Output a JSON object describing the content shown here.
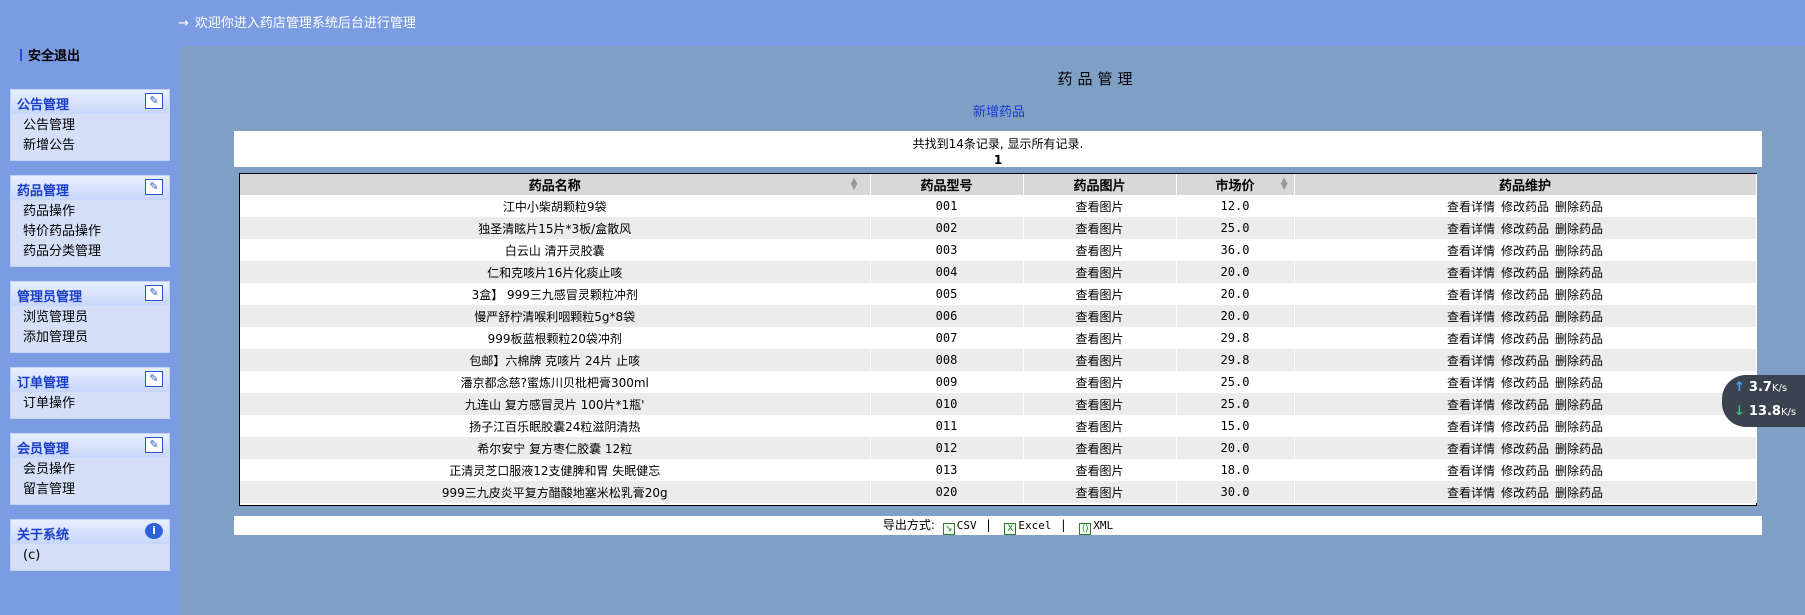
{
  "header": {
    "arrow": "→",
    "welcome": "欢迎你进入药店管理系统后台进行管理"
  },
  "sidebar": {
    "logout": "安全退出",
    "menus": [
      {
        "title": "公告管理",
        "icon": "edit-icon",
        "items": [
          "公告管理",
          "新增公告"
        ]
      },
      {
        "title": "药品管理",
        "icon": "edit-icon",
        "items": [
          "药品操作",
          "特价药品操作",
          "药品分类管理"
        ]
      },
      {
        "title": "管理员管理",
        "icon": "edit-icon",
        "items": [
          "浏览管理员",
          "添加管理员"
        ]
      },
      {
        "title": "订单管理",
        "icon": "edit-icon",
        "items": [
          "订单操作"
        ]
      },
      {
        "title": "会员管理",
        "icon": "edit-icon",
        "items": [
          "会员操作",
          "留言管理"
        ]
      },
      {
        "title": "关于系统",
        "icon": "info-icon",
        "items": [
          "(c)"
        ]
      }
    ]
  },
  "main": {
    "title": "药品管理",
    "add_link": "新增药品",
    "record_info": "共找到14条记录, 显示所有记录.",
    "page": "1",
    "columns": [
      "药品名称",
      "药品型号",
      "药品图片",
      "市场价",
      "药品维护"
    ],
    "rows": [
      {
        "name": "江中小柴胡颗粒9袋",
        "model": "001",
        "image": "查看图片",
        "price": "12.0"
      },
      {
        "name": "独圣清眩片15片*3板/盒散风",
        "model": "002",
        "image": "查看图片",
        "price": "25.0"
      },
      {
        "name": "白云山 清开灵胶囊",
        "model": "003",
        "image": "查看图片",
        "price": "36.0"
      },
      {
        "name": "仁和克咳片16片化痰止咳",
        "model": "004",
        "image": "查看图片",
        "price": "20.0"
      },
      {
        "name": "3盒】 999三九感冒灵颗粒冲剂",
        "model": "005",
        "image": "查看图片",
        "price": "20.0"
      },
      {
        "name": "慢严舒柠清喉利咽颗粒5g*8袋",
        "model": "006",
        "image": "查看图片",
        "price": "20.0"
      },
      {
        "name": "999板蓝根颗粒20袋冲剂",
        "model": "007",
        "image": "查看图片",
        "price": "29.8"
      },
      {
        "name": "包邮】六棉牌 克咳片 24片 止咳",
        "model": "008",
        "image": "查看图片",
        "price": "29.8"
      },
      {
        "name": "潘京都念慈?蜜炼川贝枇杷膏300ml",
        "model": "009",
        "image": "查看图片",
        "price": "25.0"
      },
      {
        "name": "九连山 复方感冒灵片 100片*1瓶'",
        "model": "010",
        "image": "查看图片",
        "price": "25.0"
      },
      {
        "name": "扬子江百乐眠胶囊24粒滋阴清热",
        "model": "011",
        "image": "查看图片",
        "price": "15.0"
      },
      {
        "name": "希尔安宁 复方枣仁胶囊 12粒",
        "model": "012",
        "image": "查看图片",
        "price": "20.0"
      },
      {
        "name": "正清灵芝口服液12支健脾和胃 失眠健忘",
        "model": "013",
        "image": "查看图片",
        "price": "18.0"
      },
      {
        "name": "999三九皮炎平复方醋酸地塞米松乳膏20g",
        "model": "020",
        "image": "查看图片",
        "price": "30.0"
      }
    ],
    "actions": [
      "查看详情",
      "修改药品",
      "删除药品"
    ],
    "export": {
      "label": "导出方式:",
      "options": [
        "CSV",
        "Excel",
        "XML"
      ],
      "separator": "|"
    }
  },
  "speed_widget": {
    "up_value": "3.7",
    "up_unit": "K/s",
    "down_value": "13.8",
    "down_unit": "K/s"
  }
}
